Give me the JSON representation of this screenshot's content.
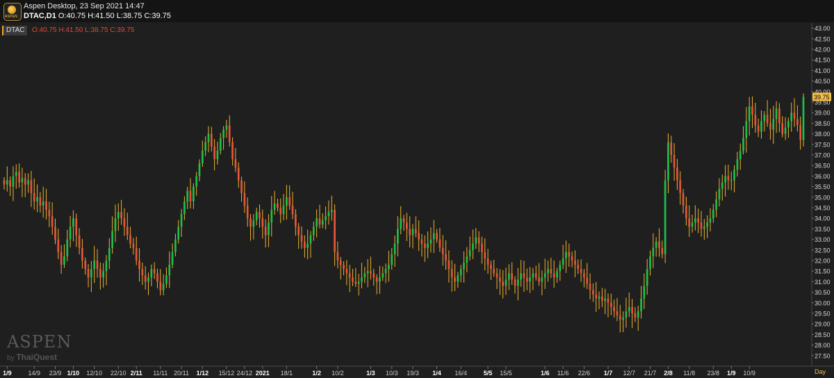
{
  "header": {
    "app_title": "Aspen Desktop, 23 Sep 2021 14:47",
    "symbol_line_symbol": "DTAC,D1",
    "symbol_line_ohlc": "O:40.75 H:41.50 L:38.75 C:39.75",
    "logo_text": "ASPEN"
  },
  "legend": {
    "symbol": "DTAC",
    "ohlc": "O:40.75  H:41.50  L:38.75  C:39.75"
  },
  "watermark": {
    "brand": "ASPEN",
    "by": "by",
    "company": "ThaiQuest"
  },
  "timeframe_label": "Day",
  "colors": {
    "up": "#1fc04a",
    "down": "#e8553a",
    "wick": "#f0b429",
    "last_price_bg": "#f5c04a"
  },
  "chart_data": {
    "type": "candlestick",
    "symbol": "DTAC",
    "timeframe": "D1",
    "ylim": [
      27.0,
      43.25
    ],
    "y_ticks": [
      "43.00",
      "42.50",
      "42.00",
      "41.50",
      "41.00",
      "40.50",
      "40.00",
      "39.50",
      "39.00",
      "38.50",
      "38.00",
      "37.50",
      "37.00",
      "36.50",
      "36.00",
      "35.50",
      "35.00",
      "34.50",
      "34.00",
      "33.50",
      "33.00",
      "32.50",
      "32.00",
      "31.50",
      "31.00",
      "30.50",
      "30.00",
      "29.50",
      "29.00",
      "28.50",
      "28.00",
      "27.50"
    ],
    "last_price": "39.75",
    "x_ticks": [
      {
        "label": "1/9",
        "idx": 1,
        "bold": true
      },
      {
        "label": "14/9",
        "idx": 10
      },
      {
        "label": "23/9",
        "idx": 17
      },
      {
        "label": "1/10",
        "idx": 23,
        "bold": true
      },
      {
        "label": "12/10",
        "idx": 30
      },
      {
        "label": "22/10",
        "idx": 38
      },
      {
        "label": "2/11",
        "idx": 44,
        "bold": true
      },
      {
        "label": "11/11",
        "idx": 52
      },
      {
        "label": "20/11",
        "idx": 59
      },
      {
        "label": "1/12",
        "idx": 66,
        "bold": true
      },
      {
        "label": "15/12",
        "idx": 74
      },
      {
        "label": "24/12",
        "idx": 80
      },
      {
        "label": "2021",
        "idx": 86,
        "bold": true
      },
      {
        "label": "18/1",
        "idx": 94
      },
      {
        "label": "1/2",
        "idx": 104,
        "bold": true
      },
      {
        "label": "10/2",
        "idx": 111
      },
      {
        "label": "1/3",
        "idx": 122,
        "bold": true
      },
      {
        "label": "10/3",
        "idx": 129
      },
      {
        "label": "19/3",
        "idx": 136
      },
      {
        "label": "1/4",
        "idx": 144,
        "bold": true
      },
      {
        "label": "16/4",
        "idx": 152
      },
      {
        "label": "5/5",
        "idx": 161,
        "bold": true
      },
      {
        "label": "15/5",
        "idx": 167
      },
      {
        "label": "1/6",
        "idx": 180,
        "bold": true
      },
      {
        "label": "11/6",
        "idx": 186
      },
      {
        "label": "22/6",
        "idx": 193
      },
      {
        "label": "1/7",
        "idx": 201,
        "bold": true
      },
      {
        "label": "12/7",
        "idx": 208
      },
      {
        "label": "21/7",
        "idx": 215
      },
      {
        "label": "2/8",
        "idx": 221,
        "bold": true
      },
      {
        "label": "11/8",
        "idx": 228
      },
      {
        "label": "23/8",
        "idx": 236
      },
      {
        "label": "1/9",
        "idx": 242,
        "bold": true
      },
      {
        "label": "10/9",
        "idx": 248
      }
    ],
    "series": [
      {
        "type": "candles",
        "close_path": [
          35.6,
          35.8,
          35.5,
          36.0,
          36.2,
          35.7,
          35.9,
          35.6,
          35.8,
          35.2,
          34.8,
          35.0,
          34.6,
          34.8,
          34.4,
          34.1,
          33.6,
          33.0,
          32.4,
          31.8,
          32.2,
          33.0,
          33.6,
          34.0,
          33.2,
          32.6,
          32.0,
          31.6,
          31.2,
          31.6,
          32.0,
          31.6,
          31.2,
          31.5,
          32.0,
          32.6,
          33.4,
          34.0,
          34.3,
          34.0,
          33.6,
          33.2,
          32.8,
          32.6,
          32.0,
          31.6,
          31.3,
          31.0,
          31.2,
          31.6,
          31.4,
          31.0,
          30.6,
          30.9,
          31.3,
          31.8,
          32.4,
          33.0,
          33.6,
          34.2,
          34.8,
          35.3,
          34.8,
          35.5,
          36.0,
          36.6,
          37.2,
          37.6,
          38.0,
          37.4,
          36.8,
          37.2,
          37.8,
          38.2,
          38.4,
          37.6,
          36.8,
          36.4,
          35.8,
          35.2,
          34.6,
          34.0,
          33.6,
          33.9,
          34.3,
          34.0,
          33.6,
          33.2,
          33.8,
          34.4,
          34.7,
          34.5,
          34.2,
          34.6,
          35.0,
          34.6,
          34.2,
          33.6,
          33.2,
          32.9,
          32.6,
          32.8,
          33.2,
          33.6,
          34.0,
          33.7,
          33.9,
          34.1,
          34.3,
          34.4,
          32.4,
          32.0,
          31.8,
          31.6,
          31.4,
          31.2,
          31.0,
          30.9,
          31.0,
          31.2,
          31.4,
          31.5,
          31.4,
          31.2,
          31.0,
          31.2,
          31.4,
          31.6,
          31.8,
          32.3,
          32.8,
          33.5,
          34.0,
          33.8,
          33.5,
          33.2,
          33.5,
          33.3,
          33.0,
          32.8,
          32.6,
          32.8,
          33.0,
          33.3,
          33.0,
          32.6,
          32.3,
          32.0,
          31.6,
          31.2,
          31.0,
          31.3,
          31.6,
          31.9,
          32.2,
          32.5,
          32.8,
          33.1,
          32.8,
          32.4,
          32.1,
          31.8,
          31.6,
          31.4,
          31.2,
          31.0,
          30.8,
          31.1,
          31.4,
          31.1,
          30.8,
          31.1,
          31.4,
          31.2,
          31.0,
          31.2,
          31.4,
          31.2,
          31.0,
          31.2,
          31.4,
          31.6,
          31.4,
          31.2,
          31.5,
          31.8,
          32.1,
          32.4,
          32.2,
          32.0,
          31.8,
          31.6,
          31.4,
          31.2,
          30.9,
          30.6,
          30.4,
          30.2,
          30.3,
          30.1,
          30.2,
          30.0,
          29.8,
          29.6,
          29.4,
          29.2,
          29.3,
          29.6,
          29.8,
          29.5,
          29.3,
          29.6,
          30.2,
          30.8,
          31.6,
          32.2,
          32.6,
          32.9,
          32.6,
          32.3,
          35.8,
          37.6,
          37.0,
          36.4,
          35.8,
          35.2,
          34.6,
          34.0,
          33.6,
          33.8,
          34.0,
          33.8,
          33.5,
          33.6,
          33.8,
          34.0,
          34.4,
          34.9,
          35.4,
          35.7,
          36.0,
          35.8,
          35.8,
          36.3,
          36.8,
          37.2,
          37.8,
          38.6,
          39.3,
          38.9,
          38.4,
          38.1,
          38.6,
          38.9,
          38.5,
          38.2,
          38.7,
          39.2,
          38.5,
          38.0,
          38.3,
          38.6,
          39.0,
          38.7,
          38.4,
          37.7,
          39.75
        ]
      }
    ]
  }
}
